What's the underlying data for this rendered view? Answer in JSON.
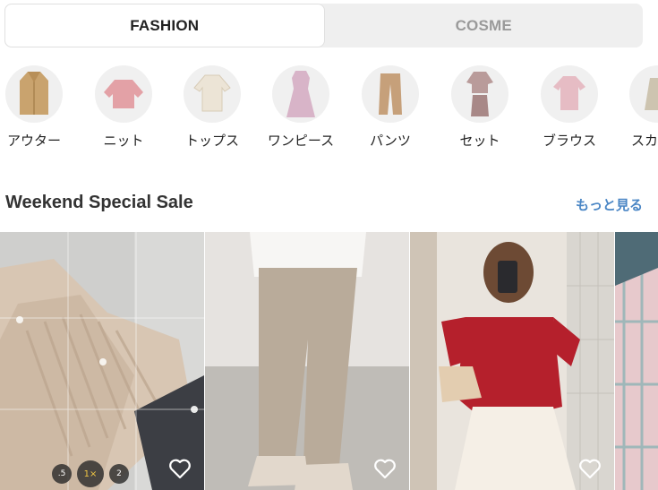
{
  "tabs": [
    {
      "label": "FASHION",
      "active": true
    },
    {
      "label": "COSME",
      "active": false
    }
  ],
  "categories": [
    {
      "label": "アウター",
      "icon": "coat-icon"
    },
    {
      "label": "ニット",
      "icon": "knit-icon"
    },
    {
      "label": "トップス",
      "icon": "tops-icon"
    },
    {
      "label": "ワンピース",
      "icon": "dress-icon"
    },
    {
      "label": "パンツ",
      "icon": "pants-icon"
    },
    {
      "label": "セット",
      "icon": "setup-icon"
    },
    {
      "label": "ブラウス",
      "icon": "blouse-icon"
    },
    {
      "label": "スカート",
      "icon": "skirt-icon"
    }
  ],
  "section": {
    "title": "Weekend Special Sale",
    "more_label": "もっと見る"
  },
  "camera_zoom": [
    ".5",
    "1×",
    "2"
  ],
  "colors": {
    "accent": "#4a86c5",
    "tab_bg": "#efefef",
    "circle_bg": "#f0f0f0"
  }
}
